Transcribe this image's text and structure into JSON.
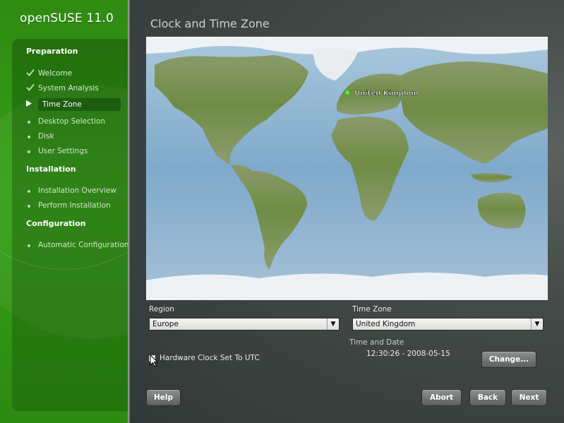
{
  "app": {
    "logo": "openSUSE 11.0"
  },
  "sidebar": {
    "groups": [
      {
        "title": "Preparation",
        "steps": [
          {
            "label": "Welcome",
            "state": "done"
          },
          {
            "label": "System Analysis",
            "state": "done"
          },
          {
            "label": "Time Zone",
            "state": "current"
          },
          {
            "label": "Desktop Selection",
            "state": "pending"
          },
          {
            "label": "Disk",
            "state": "pending"
          },
          {
            "label": "User Settings",
            "state": "pending"
          }
        ]
      },
      {
        "title": "Installation",
        "steps": [
          {
            "label": "Installation Overview",
            "state": "pending"
          },
          {
            "label": "Perform Installation",
            "state": "pending"
          }
        ]
      },
      {
        "title": "Configuration",
        "steps": [
          {
            "label": "Automatic Configuration",
            "state": "pending"
          }
        ]
      }
    ],
    "icons": {
      "done": "checkmark-icon",
      "current": "play-arrow-icon",
      "pending": "bullet-dot-icon"
    }
  },
  "main": {
    "title": "Clock and Time Zone",
    "map": {
      "selected_label": "United Kingdom"
    },
    "region": {
      "label": "Region",
      "value": "Europe"
    },
    "timezone": {
      "label": "Time Zone",
      "value": "United Kingdom"
    },
    "time_date": {
      "label": "Time and Date",
      "value": "12:30:26 - 2008-05-15"
    },
    "utc_checkbox": {
      "label": "Hardware Clock Set To UTC",
      "checked": false
    },
    "change_button": "Change..."
  },
  "footer": {
    "help": "Help",
    "abort": "Abort",
    "back": "Back",
    "next": "Next"
  },
  "colors": {
    "sidebar_green": "#35a015",
    "background": "#3d4442",
    "map_ocean": "#8db6d6",
    "map_land": "#7d9a52",
    "marker": "#33ff33"
  }
}
